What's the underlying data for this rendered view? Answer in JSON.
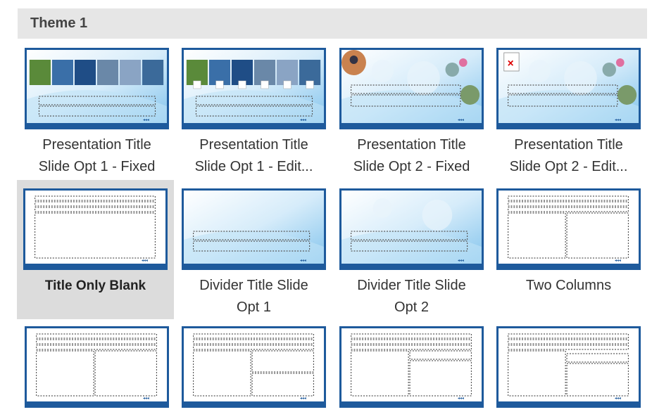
{
  "section": {
    "title": "Theme 1"
  },
  "layouts": [
    {
      "label_line1": "Presentation Title",
      "label_line2": "Slide Opt 1 - Fixed",
      "variant": "photo-strip",
      "selected": false
    },
    {
      "label_line1": "Presentation Title",
      "label_line2": "Slide Opt 1 - Edit...",
      "variant": "photo-strip-edit",
      "selected": false
    },
    {
      "label_line1": "Presentation Title",
      "label_line2": "Slide Opt 2 - Fixed",
      "variant": "bubbles",
      "selected": false
    },
    {
      "label_line1": "Presentation Title",
      "label_line2": "Slide Opt 2 - Edit...",
      "variant": "bubbles-edit",
      "selected": false
    },
    {
      "label_line1": "Title Only Blank",
      "label_line2": "",
      "variant": "title-only",
      "selected": true
    },
    {
      "label_line1": "Divider Title Slide",
      "label_line2": "Opt 1",
      "variant": "divider1",
      "selected": false
    },
    {
      "label_line1": "Divider Title Slide",
      "label_line2": "Opt 2",
      "variant": "divider2",
      "selected": false
    },
    {
      "label_line1": "Two Columns",
      "label_line2": "",
      "variant": "two-columns",
      "selected": false
    },
    {
      "label_line1": "",
      "label_line2": "",
      "variant": "two-columns",
      "selected": false
    },
    {
      "label_line1": "",
      "label_line2": "",
      "variant": "col-split-right",
      "selected": false
    },
    {
      "label_line1": "",
      "label_line2": "",
      "variant": "col-split-right-2",
      "selected": false
    },
    {
      "label_line1": "",
      "label_line2": "",
      "variant": "col-split-right-3",
      "selected": false
    }
  ],
  "colors": {
    "accent": "#1e5a9c",
    "header_bg": "#e6e6e6",
    "selected_bg": "#dcdcdc"
  }
}
